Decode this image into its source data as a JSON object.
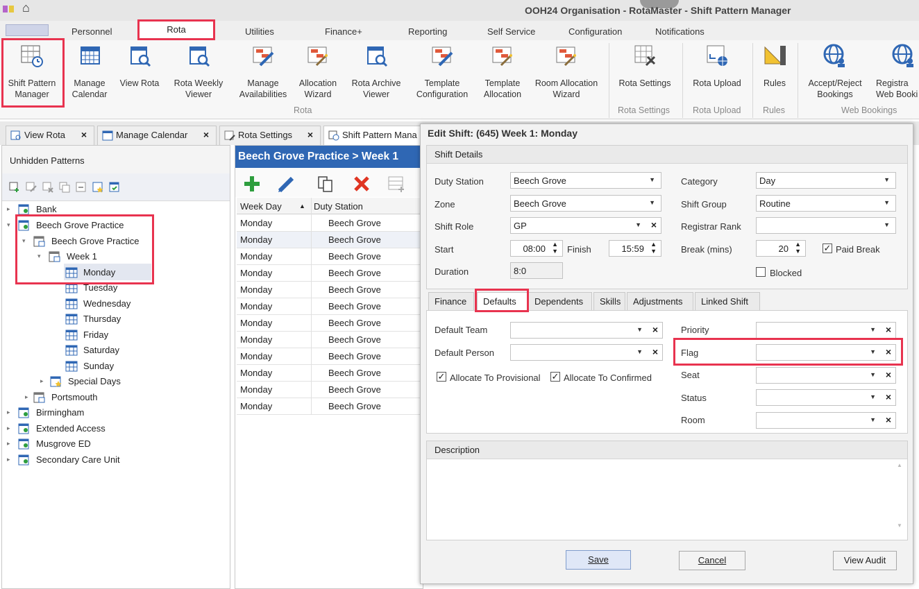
{
  "titlebar": {
    "title": "OOH24 Organisation - RotaMaster - Shift Pattern Manager"
  },
  "menu_tabs": [
    "Personnel",
    "Rota",
    "Utilities",
    "Finance+",
    "Reporting",
    "Self Service",
    "Configuration",
    "Notifications"
  ],
  "ribbon": {
    "buttons": [
      {
        "label": "Shift Pattern\nManager",
        "icon": "shift-pattern-icon"
      },
      {
        "label": "Manage\nCalendar",
        "icon": "calendar-icon"
      },
      {
        "label": "View Rota",
        "icon": "view-rota-icon"
      },
      {
        "label": "Rota Weekly\nViewer",
        "icon": "weekly-viewer-icon"
      },
      {
        "label": "Manage\nAvailabilities",
        "icon": "availability-icon"
      },
      {
        "label": "Allocation\nWizard",
        "icon": "allocation-wizard-icon"
      },
      {
        "label": "Rota Archive\nViewer",
        "icon": "archive-viewer-icon"
      },
      {
        "label": "Template\nConfiguration",
        "icon": "template-config-icon"
      },
      {
        "label": "Template\nAllocation",
        "icon": "template-allocation-icon"
      },
      {
        "label": "Room Allocation\nWizard",
        "icon": "room-allocation-icon"
      },
      {
        "label": "Rota Settings",
        "icon": "rota-settings-icon"
      },
      {
        "label": "Rota Upload",
        "icon": "rota-upload-icon"
      },
      {
        "label": "Rules",
        "icon": "rules-icon"
      },
      {
        "label": "Accept/Reject\nBookings",
        "icon": "globe-user-icon"
      },
      {
        "label": "Registra\nWeb Booki",
        "icon": "globe-user-icon"
      }
    ],
    "groups": [
      "Rota",
      "Rota Settings",
      "Rota Upload",
      "Rules",
      "Web Bookings"
    ]
  },
  "doc_tabs": [
    "View Rota",
    "Manage Calendar",
    "Rota Settings",
    "Shift Pattern Mana"
  ],
  "left_panel": {
    "header": "Unhidden Patterns",
    "tree": [
      {
        "label": "Bank"
      },
      {
        "label": "Beech Grove Practice"
      },
      {
        "label": "Beech Grove Practice"
      },
      {
        "label": "Week 1"
      },
      {
        "label": "Monday"
      },
      {
        "label": "Tuesday"
      },
      {
        "label": "Wednesday"
      },
      {
        "label": "Thursday"
      },
      {
        "label": "Friday"
      },
      {
        "label": "Saturday"
      },
      {
        "label": "Sunday"
      },
      {
        "label": "Special Days"
      },
      {
        "label": "Portsmouth"
      },
      {
        "label": "Birmingham"
      },
      {
        "label": "Extended Access"
      },
      {
        "label": "Musgrove ED"
      },
      {
        "label": "Secondary Care Unit"
      }
    ]
  },
  "mid_panel": {
    "header": "Beech Grove Practice > Week 1",
    "columns": [
      "Week Day",
      "Duty Station"
    ],
    "rows": [
      [
        "Monday",
        "Beech Grove"
      ],
      [
        "Monday",
        "Beech Grove"
      ],
      [
        "Monday",
        "Beech Grove"
      ],
      [
        "Monday",
        "Beech Grove"
      ],
      [
        "Monday",
        "Beech Grove"
      ],
      [
        "Monday",
        "Beech Grove"
      ],
      [
        "Monday",
        "Beech Grove"
      ],
      [
        "Monday",
        "Beech Grove"
      ],
      [
        "Monday",
        "Beech Grove"
      ],
      [
        "Monday",
        "Beech Grove"
      ],
      [
        "Monday",
        "Beech Grove"
      ],
      [
        "Monday",
        "Beech Grove"
      ]
    ]
  },
  "dialog": {
    "title": "Edit Shift: (645) Week 1: Monday",
    "shift_details": {
      "title": "Shift Details",
      "duty_station_label": "Duty Station",
      "duty_station": "Beech Grove",
      "zone_label": "Zone",
      "zone": "Beech Grove",
      "shift_role_label": "Shift Role",
      "shift_role": "GP",
      "start_label": "Start",
      "start": "08:00",
      "finish_label": "Finish",
      "finish": "15:59",
      "duration_label": "Duration",
      "duration": "8:0",
      "category_label": "Category",
      "category": "Day",
      "shift_group_label": "Shift Group",
      "shift_group": "Routine",
      "registrar_rank_label": "Registrar Rank",
      "registrar_rank": "",
      "break_label": "Break (mins)",
      "break": "20",
      "paid_break_label": "Paid Break",
      "blocked_label": "Blocked"
    },
    "tabs": [
      "Finance",
      "Defaults",
      "Dependents",
      "Skills",
      "Adjustments",
      "Linked Shift"
    ],
    "defaults": {
      "default_team_label": "Default Team",
      "default_person_label": "Default Person",
      "allocate_provisional_label": "Allocate To Provisional",
      "allocate_confirmed_label": "Allocate To Confirmed",
      "priority_label": "Priority",
      "flag_label": "Flag",
      "seat_label": "Seat",
      "status_label": "Status",
      "room_label": "Room"
    },
    "description": {
      "title": "Description"
    },
    "buttons": {
      "save": "Save",
      "cancel": "Cancel",
      "view_audit": "View Audit"
    }
  }
}
